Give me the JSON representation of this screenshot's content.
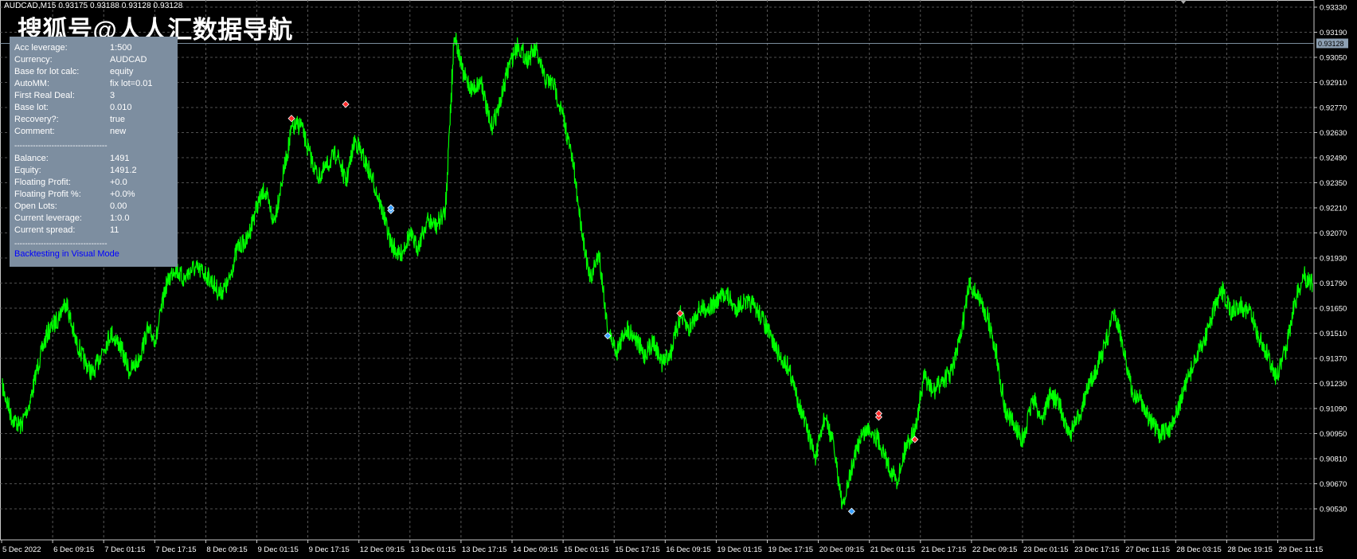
{
  "header": {
    "symbol_ohlc": "AUDCAD,M15  0.93175 0.93188 0.93128 0.93128"
  },
  "watermark": "搜狐号@人人汇数据导航",
  "info_panel": {
    "rows1": [
      {
        "key": "Acc leverage:",
        "value": "1:500"
      },
      {
        "key": "Currency:",
        "value": "AUDCAD"
      },
      {
        "key": "Base for lot calc:",
        "value": "equity"
      },
      {
        "key": "AutoMM:",
        "value": "fix lot=0.01"
      },
      {
        "key": "First Real Deal:",
        "value": "3"
      },
      {
        "key": "Base lot:",
        "value": "0.010"
      },
      {
        "key": "Recovery?:",
        "value": "true"
      },
      {
        "key": "Comment:",
        "value": "new"
      }
    ],
    "separator": "-----------------------------------",
    "rows2": [
      {
        "key": "Balance:",
        "value": "1491"
      },
      {
        "key": "Equity:",
        "value": "1491.2"
      },
      {
        "key": "Floating Profit:",
        "value": "+0.0"
      },
      {
        "key": "Floating Profit %:",
        "value": "+0.0%"
      },
      {
        "key": "Open Lots:",
        "value": "0.00"
      },
      {
        "key": "Current leverage:",
        "value": "1:0.0"
      },
      {
        "key": "Current spread:",
        "value": "11"
      }
    ],
    "mode_link": "Backtesting in Visual Mode"
  },
  "colors": {
    "background": "#000000",
    "price_line": "#00ff00",
    "grid": "#6b6b6b",
    "panel": "#7d8ea0",
    "sell_arrow": "#ff2a2a",
    "buy_arrow": "#3aa0ff",
    "current_price_tag": "#8da0b3"
  },
  "chart_data": {
    "type": "line",
    "symbol": "AUDCAD",
    "timeframe": "M15",
    "current_price": "0.93128",
    "y_ticks": [
      "0.93330",
      "0.93190",
      "0.93050",
      "0.92910",
      "0.92770",
      "0.92630",
      "0.92490",
      "0.92350",
      "0.92210",
      "0.92070",
      "0.91930",
      "0.91790",
      "0.91650",
      "0.91510",
      "0.91370",
      "0.91230",
      "0.91090",
      "0.90950",
      "0.90810",
      "0.90670",
      "0.90530"
    ],
    "x_ticks": [
      "5 Dec 2022",
      "6 Dec 09:15",
      "7 Dec 01:15",
      "7 Dec 17:15",
      "8 Dec 09:15",
      "9 Dec 01:15",
      "9 Dec 17:15",
      "12 Dec 09:15",
      "13 Dec 01:15",
      "13 Dec 17:15",
      "14 Dec 09:15",
      "15 Dec 01:15",
      "15 Dec 17:15",
      "16 Dec 09:15",
      "19 Dec 01:15",
      "19 Dec 17:15",
      "20 Dec 09:15",
      "21 Dec 01:15",
      "21 Dec 17:15",
      "22 Dec 09:15",
      "23 Dec 01:15",
      "23 Dec 17:15",
      "27 Dec 11:15",
      "28 Dec 03:15",
      "28 Dec 19:15",
      "29 Dec 11:15"
    ],
    "ylim": [
      0.9046,
      0.9334
    ],
    "close_path": [
      0.9121,
      0.9104,
      0.9099,
      0.9112,
      0.9135,
      0.9152,
      0.9158,
      0.9169,
      0.9148,
      0.9136,
      0.9128,
      0.9141,
      0.9151,
      0.9144,
      0.913,
      0.9135,
      0.9152,
      0.9148,
      0.9176,
      0.9188,
      0.9181,
      0.9187,
      0.9186,
      0.9181,
      0.9173,
      0.9179,
      0.9199,
      0.9202,
      0.922,
      0.9231,
      0.9213,
      0.9238,
      0.9265,
      0.9268,
      0.925,
      0.9238,
      0.9245,
      0.9252,
      0.9235,
      0.9259,
      0.9248,
      0.9236,
      0.922,
      0.9201,
      0.9194,
      0.9206,
      0.9199,
      0.9214,
      0.9211,
      0.9219,
      0.9319,
      0.9295,
      0.9287,
      0.9292,
      0.9265,
      0.9278,
      0.93,
      0.9312,
      0.9304,
      0.9309,
      0.9293,
      0.929,
      0.9272,
      0.925,
      0.9213,
      0.918,
      0.9196,
      0.9152,
      0.9141,
      0.9154,
      0.9149,
      0.9138,
      0.9147,
      0.9134,
      0.9141,
      0.9161,
      0.9153,
      0.9164,
      0.9165,
      0.9168,
      0.9174,
      0.9165,
      0.9168,
      0.9167,
      0.916,
      0.9149,
      0.9138,
      0.9132,
      0.9114,
      0.9098,
      0.9081,
      0.9105,
      0.9088,
      0.9053,
      0.9076,
      0.9094,
      0.9098,
      0.9091,
      0.9078,
      0.9068,
      0.9089,
      0.9097,
      0.9127,
      0.9118,
      0.9125,
      0.9129,
      0.9148,
      0.9178,
      0.9171,
      0.916,
      0.9139,
      0.9107,
      0.9099,
      0.9091,
      0.9115,
      0.9103,
      0.9117,
      0.9111,
      0.9094,
      0.9103,
      0.9118,
      0.9131,
      0.9144,
      0.9162,
      0.9145,
      0.9117,
      0.9114,
      0.9102,
      0.9094,
      0.9097,
      0.9107,
      0.9123,
      0.9136,
      0.9147,
      0.9163,
      0.9174,
      0.9163,
      0.9167,
      0.9163,
      0.9149,
      0.9139,
      0.9126,
      0.9142,
      0.9168,
      0.9183,
      0.9179
    ],
    "trade_markers": [
      {
        "side": "sell",
        "index": 32,
        "price": 0.92709
      },
      {
        "side": "sell",
        "index": 38,
        "price": 0.92788
      },
      {
        "side": "buy",
        "index": 43,
        "price": 0.92195
      },
      {
        "side": "buy",
        "index": 43,
        "price": 0.9221
      },
      {
        "side": "buy",
        "index": 67,
        "price": 0.91496
      },
      {
        "side": "sell",
        "index": 75,
        "price": 0.91621
      },
      {
        "side": "buy",
        "index": 94,
        "price": 0.90516
      },
      {
        "side": "sell",
        "index": 97,
        "price": 0.91042
      },
      {
        "side": "sell",
        "index": 97,
        "price": 0.91062
      },
      {
        "side": "sell",
        "index": 101,
        "price": 0.90917
      }
    ],
    "grid": true
  }
}
